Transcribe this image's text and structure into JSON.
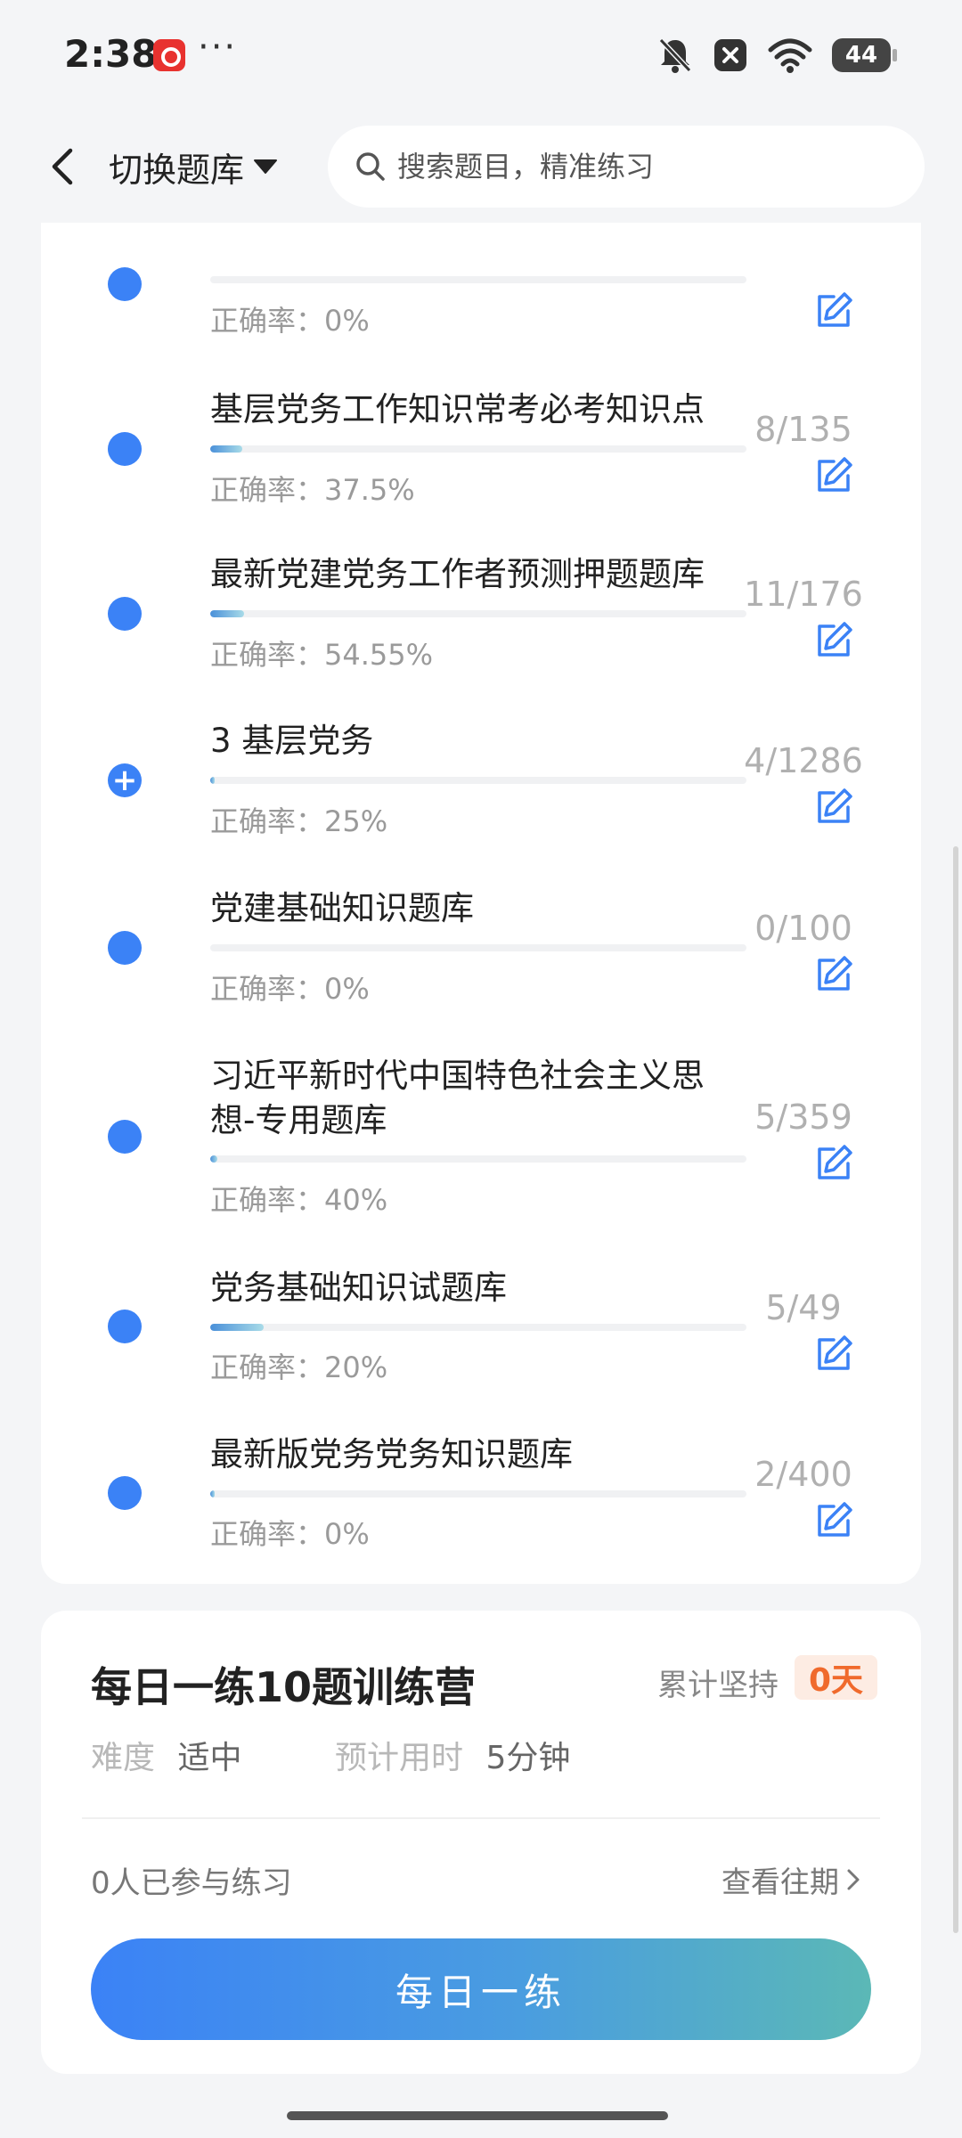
{
  "status_bar": {
    "time": "2:38",
    "dots": "···",
    "battery": "44"
  },
  "header": {
    "switch_label": "切换题库",
    "search_placeholder": "搜索题目，精准练习"
  },
  "accuracy_prefix": "正确率：",
  "banks": [
    {
      "title": "",
      "accuracy": "0%",
      "count": "",
      "progress": 0,
      "icon": "dot"
    },
    {
      "title": "基层党务工作知识常考必考知识点",
      "accuracy": "37.5%",
      "count": "8/135",
      "progress": 0.06,
      "icon": "dot"
    },
    {
      "title": "最新党建党务工作者预测押题题库",
      "accuracy": "54.55%",
      "count": "11/176",
      "progress": 0.063,
      "icon": "dot"
    },
    {
      "title": "3 基层党务",
      "accuracy": "25%",
      "count": "4/1286",
      "progress": 0.003,
      "icon": "plus"
    },
    {
      "title": "党建基础知识题库",
      "accuracy": "0%",
      "count": "0/100",
      "progress": 0,
      "icon": "dot"
    },
    {
      "title": "习近平新时代中国特色社会主义思想-专用题库",
      "accuracy": "40%",
      "count": "5/359",
      "progress": 0.014,
      "icon": "dot"
    },
    {
      "title": "党务基础知识试题库",
      "accuracy": "20%",
      "count": "5/49",
      "progress": 0.1,
      "icon": "dot"
    },
    {
      "title": "最新版党务党务知识题库",
      "accuracy": "0%",
      "count": "2/400",
      "progress": 0.005,
      "icon": "dot"
    }
  ],
  "daily": {
    "title": "每日一练10题训练营",
    "persist_label": "累计坚持",
    "persist_value": "0天",
    "difficulty_label": "难度",
    "difficulty_value": "适中",
    "time_label": "预计用时",
    "time_value": "5分钟",
    "participants": "0人已参与练习",
    "history_link": "查看往期",
    "button_label": "每日一练"
  },
  "colors": {
    "accent": "#3b82f6",
    "badge_text": "#f06a2c",
    "badge_bg": "#fdece3",
    "button_gradient_end": "#5bb8b6"
  }
}
